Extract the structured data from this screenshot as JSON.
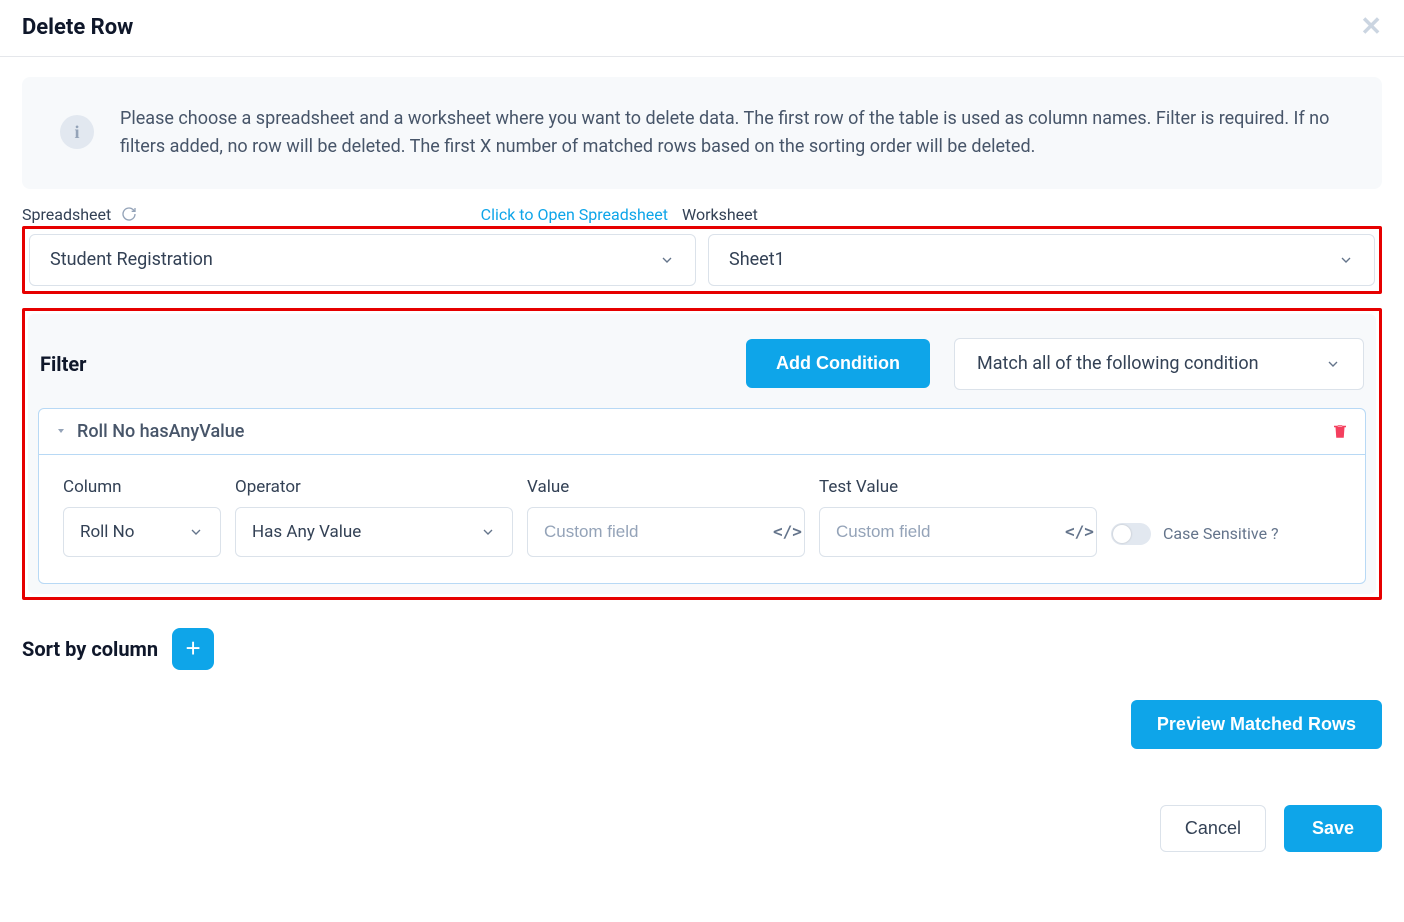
{
  "header": {
    "title": "Delete Row"
  },
  "info": {
    "text": "Please choose a spreadsheet and a worksheet where you want to delete data. The first row of the table is used as column names. Filter is required. If no filters added, no row will be deleted. The first X number of matched rows based on the sorting order will be deleted."
  },
  "spreadsheet": {
    "label": "Spreadsheet",
    "open_link": "Click to Open Spreadsheet",
    "value": "Student Registration"
  },
  "worksheet": {
    "label": "Worksheet",
    "value": "Sheet1"
  },
  "filter": {
    "title": "Filter",
    "add_condition_label": "Add Condition",
    "match_mode": "Match all of the following condition",
    "condition": {
      "summary": "Roll No hasAnyValue",
      "column_label": "Column",
      "column_value": "Roll No",
      "operator_label": "Operator",
      "operator_value": "Has Any Value",
      "value_label": "Value",
      "value_placeholder": "Custom field",
      "test_label": "Test Value",
      "test_placeholder": "Custom field",
      "case_label": "Case Sensitive ?"
    }
  },
  "sort": {
    "label": "Sort by column"
  },
  "preview": {
    "label": "Preview Matched Rows"
  },
  "footer": {
    "cancel": "Cancel",
    "save": "Save"
  }
}
